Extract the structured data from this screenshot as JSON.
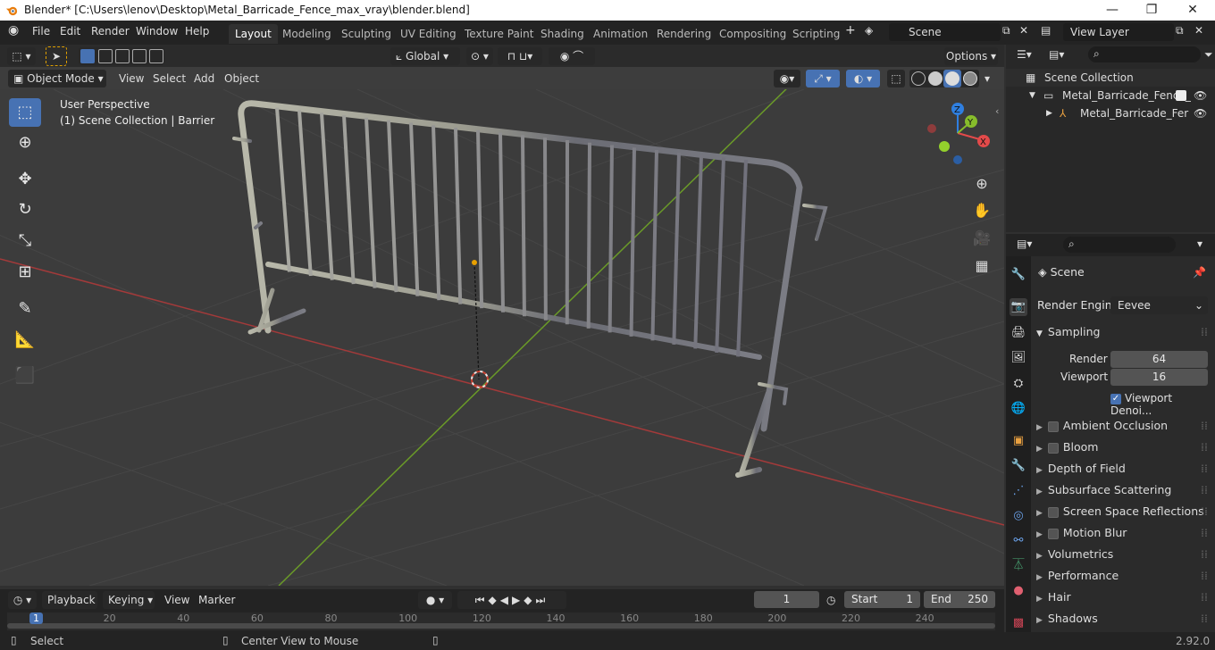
{
  "window": {
    "title": "Blender* [C:\\Users\\lenov\\Desktop\\Metal_Barricade_Fence_max_vray\\blender.blend]",
    "minimize": "—",
    "maximize": "❐",
    "close": "✕"
  },
  "menu": [
    "File",
    "Edit",
    "Render",
    "Window",
    "Help"
  ],
  "workspaces": [
    "Layout",
    "Modeling",
    "Sculpting",
    "UV Editing",
    "Texture Paint",
    "Shading",
    "Animation",
    "Rendering",
    "Compositing",
    "Scripting"
  ],
  "scene": {
    "label": "Scene",
    "view_layer": "View Layer"
  },
  "viewport_header": {
    "transform_orientation": "Global",
    "options": "Options",
    "mode": "Object Mode",
    "view": "View",
    "select": "Select",
    "add": "Add",
    "object": "Object"
  },
  "viewport": {
    "perspective": "User Perspective",
    "collection_info": "(1) Scene Collection | Barrier",
    "gizmo": {
      "x": "X",
      "y": "Y",
      "z": "Z"
    }
  },
  "outliner": {
    "root": "Scene Collection",
    "collection": "Metal_Barricade_Fence_",
    "object": "Metal_Barricade_Fer"
  },
  "properties": {
    "context": "Scene",
    "render_engine_label": "Render Engine",
    "render_engine": "Eevee",
    "sampling": "Sampling",
    "render_label": "Render",
    "render_samples": "64",
    "viewport_label": "Viewport",
    "viewport_samples": "16",
    "viewport_denoise": "Viewport Denoi...",
    "panels": [
      {
        "label": "Ambient Occlusion",
        "checkbox": true
      },
      {
        "label": "Bloom",
        "checkbox": true
      },
      {
        "label": "Depth of Field",
        "checkbox": false
      },
      {
        "label": "Subsurface Scattering",
        "checkbox": false
      },
      {
        "label": "Screen Space Reflections",
        "checkbox": true
      },
      {
        "label": "Motion Blur",
        "checkbox": true
      },
      {
        "label": "Volumetrics",
        "checkbox": false
      },
      {
        "label": "Performance",
        "checkbox": false
      },
      {
        "label": "Hair",
        "checkbox": false
      },
      {
        "label": "Shadows",
        "checkbox": false
      }
    ]
  },
  "timeline": {
    "playback": "Playback",
    "keying": "Keying",
    "view": "View",
    "marker": "Marker",
    "current_frame": "1",
    "start_label": "Start",
    "start": "1",
    "end_label": "End",
    "end": "250",
    "ruler": [
      "1",
      "20",
      "40",
      "60",
      "80",
      "100",
      "120",
      "140",
      "160",
      "180",
      "200",
      "220",
      "240"
    ]
  },
  "status": {
    "select": "Select",
    "center_view": "Center View to Mouse",
    "version": "2.92.0"
  },
  "colors": {
    "accent": "#4772b3",
    "x_axis": "#a33a3a",
    "y_axis": "#6a9a28",
    "gizmo_x": "#e34a4a",
    "gizmo_y": "#87bd2b",
    "gizmo_z": "#2f7fe0"
  }
}
